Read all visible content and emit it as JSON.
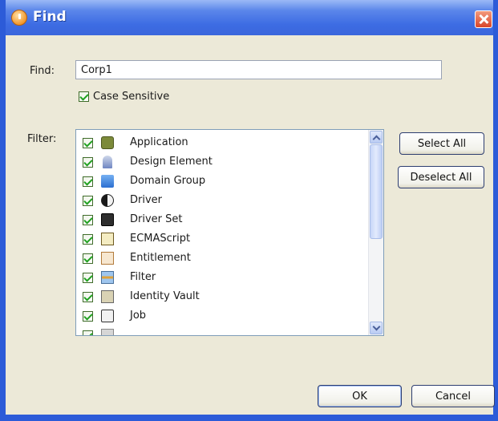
{
  "window": {
    "title": "Find",
    "close_icon": "close-icon"
  },
  "find": {
    "label": "Find:",
    "value": "Corp1"
  },
  "case_sensitive": {
    "label": "Case Sensitive",
    "checked": true
  },
  "filter": {
    "label": "Filter:",
    "items": [
      {
        "label": "Application",
        "checked": true,
        "icon": "application-icon"
      },
      {
        "label": "Design Element",
        "checked": true,
        "icon": "design-element-icon"
      },
      {
        "label": "Domain Group",
        "checked": true,
        "icon": "domain-group-icon"
      },
      {
        "label": "Driver",
        "checked": true,
        "icon": "driver-icon"
      },
      {
        "label": "Driver Set",
        "checked": true,
        "icon": "driver-set-icon"
      },
      {
        "label": "ECMAScript",
        "checked": true,
        "icon": "ecmascript-icon"
      },
      {
        "label": "Entitlement",
        "checked": true,
        "icon": "entitlement-icon"
      },
      {
        "label": "Filter",
        "checked": true,
        "icon": "filter-icon"
      },
      {
        "label": "Identity Vault",
        "checked": true,
        "icon": "identity-vault-icon"
      },
      {
        "label": "Job",
        "checked": true,
        "icon": "job-icon"
      }
    ]
  },
  "buttons": {
    "select_all": "Select All",
    "deselect_all": "Deselect All",
    "ok": "OK",
    "cancel": "Cancel"
  }
}
